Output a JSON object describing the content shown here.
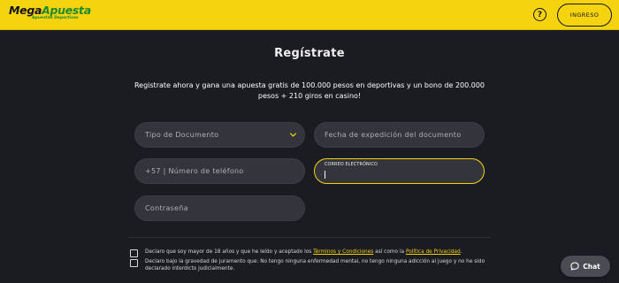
{
  "header": {
    "logo_main_1": "Mega",
    "logo_main_2": "Apuesta",
    "logo_sub": "Apuestas Deportivas",
    "help_label": "?",
    "login_label": "INGRESO"
  },
  "form": {
    "title": "Regístrate",
    "subtitle": "Registrate ahora y gana una apuesta gratis de 100.000 pesos en deportivas y un bono de 200.000 pesos + 210 giros en casino!",
    "document_type_placeholder": "Tipo de Documento",
    "document_date_placeholder": "Fecha de expedición del documento",
    "phone_placeholder": "+57 | Número de teléfono",
    "email_label": "CORREO ELECTRÓNICO",
    "email_value": "",
    "password_placeholder": "Contraseña"
  },
  "consents": {
    "terms_prefix": "Declaro que soy mayor de 18 años y que he leído y aceptado los ",
    "terms_link": "Términos y Condiciones",
    "terms_middle": " así como la ",
    "privacy_link": "Política de Privacidad",
    "terms_suffix": ".",
    "health_text": "Declaro bajo la gravedad de juramento que: No tengo ninguna enfermedad mental, no tengo ninguna adicción al juego y no he sido declarado interdicto judicialmente."
  },
  "chat": {
    "label": "Chat"
  },
  "colors": {
    "brand_yellow": "#f5d40f",
    "background": "#1b1b22",
    "field_bg": "#34343c",
    "logo_green": "#1e8a2e"
  },
  "icons": {
    "help": "question-circle-icon",
    "dropdown": "chevron-down-icon",
    "chat": "chat-bubble-icon"
  }
}
